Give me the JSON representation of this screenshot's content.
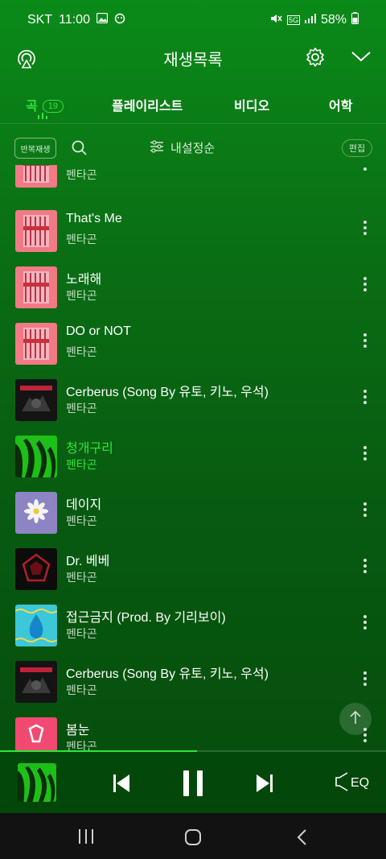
{
  "status": {
    "carrier": "SKT",
    "time": "11:00",
    "network": "5G",
    "battery": "58%"
  },
  "header": {
    "title": "재생목록"
  },
  "tabs": [
    {
      "label": "곡",
      "count": "19"
    },
    {
      "label": "플레이리스트"
    },
    {
      "label": "비디오"
    },
    {
      "label": "어학"
    }
  ],
  "toolbar": {
    "repeat_label": "반복재생",
    "sort_label": "내설정순",
    "edit_label": "편집"
  },
  "songs": [
    {
      "title": "",
      "artist": "펜타곤",
      "cover": "pink"
    },
    {
      "title": "That's Me",
      "artist": "펜타곤",
      "cover": "pink"
    },
    {
      "title": "노래해",
      "artist": "펜타곤",
      "cover": "pink"
    },
    {
      "title": "DO or NOT",
      "artist": "펜타곤",
      "cover": "pink"
    },
    {
      "title": "Cerberus (Song By 유토, 키노, 우석)",
      "artist": "펜타곤",
      "cover": "dark"
    },
    {
      "title": "청개구리",
      "artist": "펜타곤",
      "cover": "green",
      "playing": true
    },
    {
      "title": "데이지",
      "artist": "펜타곤",
      "cover": "purple"
    },
    {
      "title": "Dr. 베베",
      "artist": "펜타곤",
      "cover": "black-red"
    },
    {
      "title": "접근금지 (Prod. By 기리보이)",
      "artist": "펜타곤",
      "cover": "cyan"
    },
    {
      "title": "Cerberus (Song By 유토, 키노, 우석)",
      "artist": "펜타곤",
      "cover": "dark"
    },
    {
      "title": "봄눈",
      "artist": "펜타곤",
      "cover": "pink-logo"
    }
  ],
  "player": {
    "progress": 0.51,
    "eq_label": "EQ"
  },
  "colors": {
    "accent": "#2ee53a",
    "background": "#0a7a16"
  }
}
